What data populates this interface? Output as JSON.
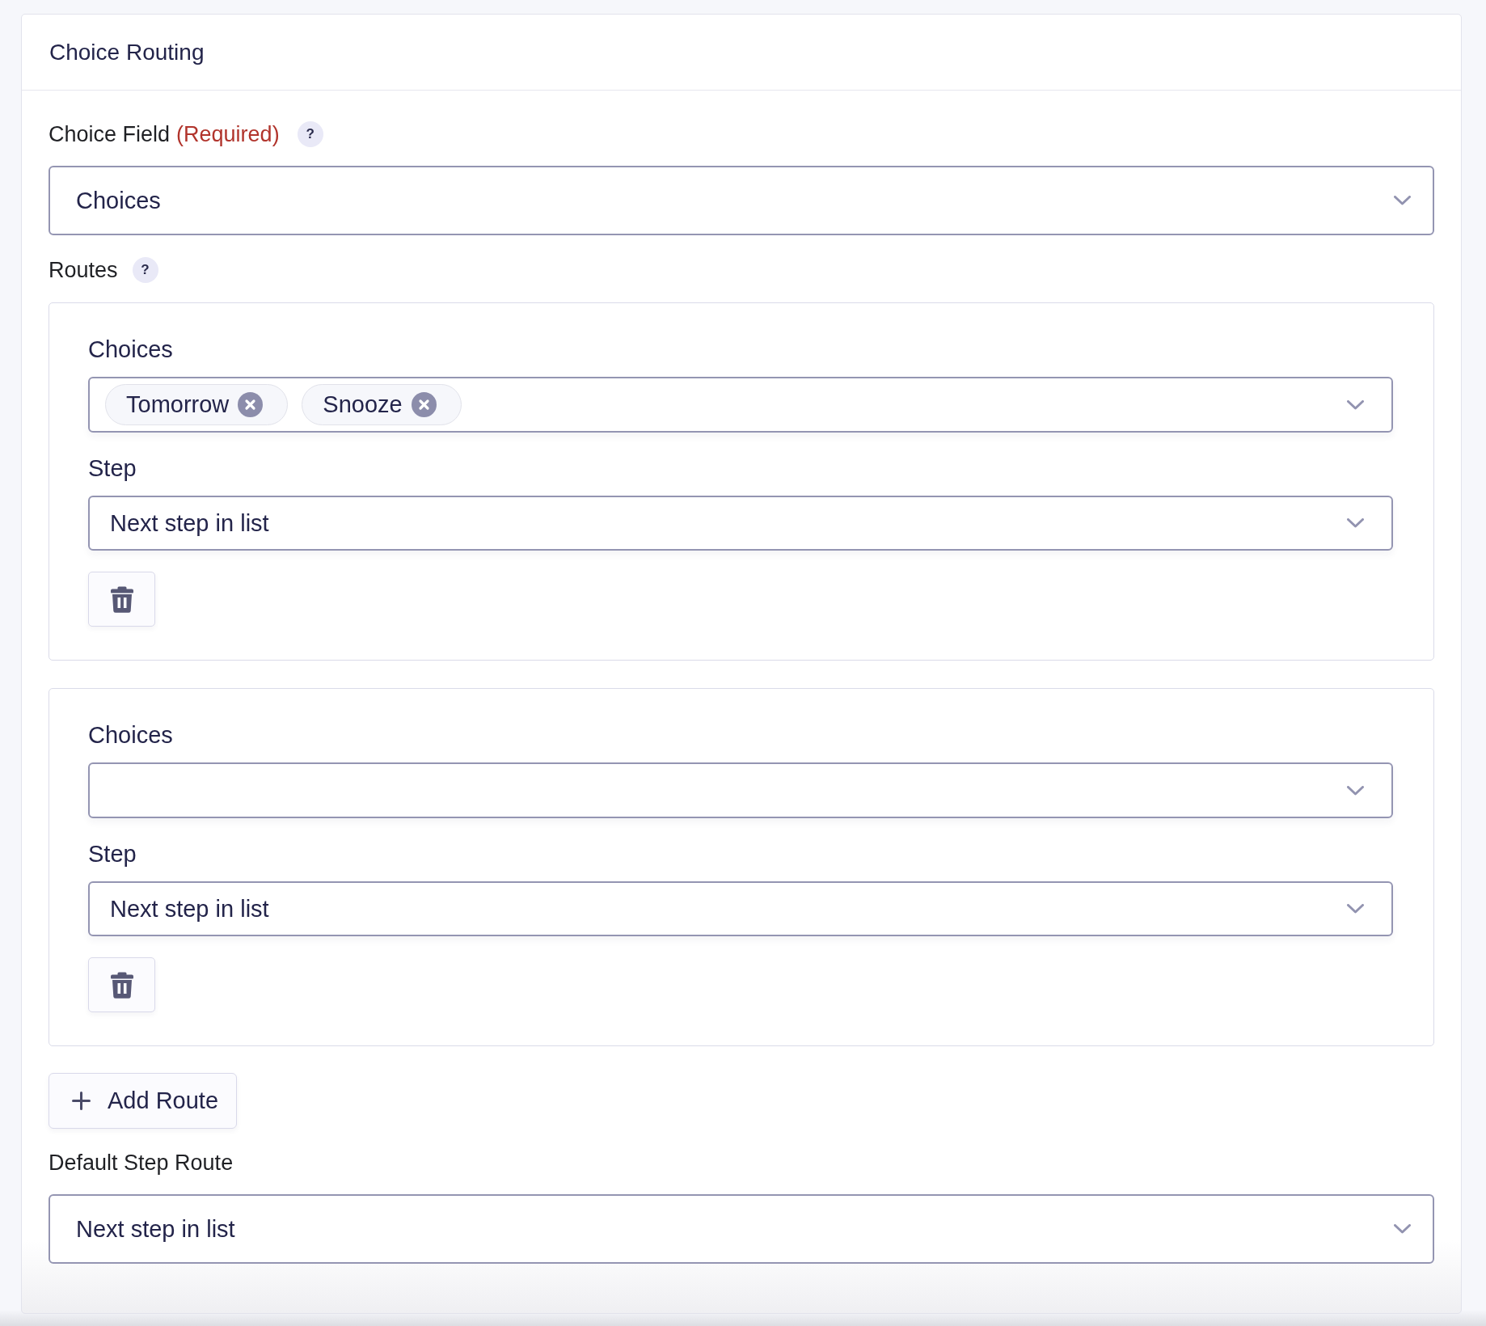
{
  "panel": {
    "title": "Choice Routing"
  },
  "choice_field": {
    "label": "Choice Field",
    "required_note": "(Required)",
    "help": "?",
    "value": "Choices"
  },
  "routes_section": {
    "label": "Routes",
    "help": "?"
  },
  "routes": [
    {
      "choices_label": "Choices",
      "chips": [
        "Tomorrow",
        "Snooze"
      ],
      "step_label": "Step",
      "step_value": "Next step in list"
    },
    {
      "choices_label": "Choices",
      "step_label": "Step",
      "step_value": "Next step in list"
    }
  ],
  "add_route_button": {
    "label": "Add Route"
  },
  "default_step_route": {
    "label": "Default Step Route",
    "value": "Next step in list"
  }
}
